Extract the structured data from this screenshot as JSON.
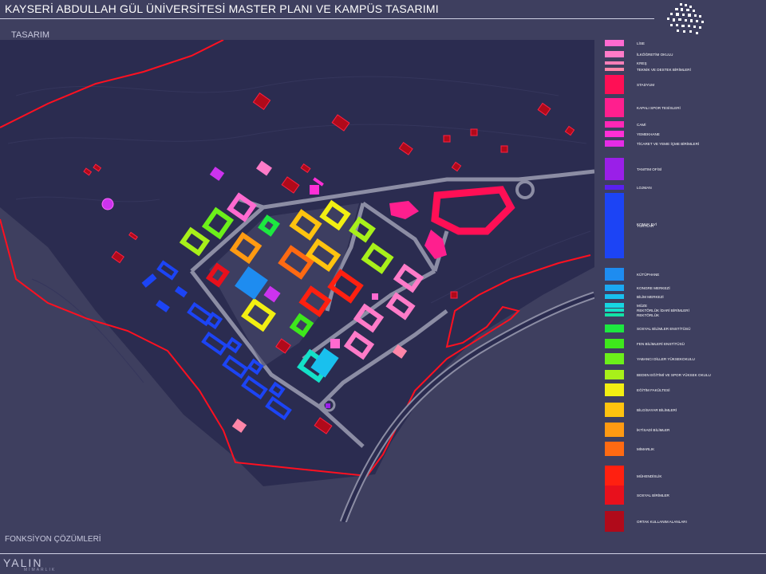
{
  "header": {
    "title": "KAYSERİ ABDULLAH GÜL ÜNİVERSİTESİ MASTER PLANI VE KAMPÜS TASARIMI",
    "section": "TASARIM"
  },
  "footer": {
    "label": "FONKSİYON ÇÖZÜMLERİ",
    "brand": "YALIN",
    "brand_sub": "MİMARLIK"
  },
  "colors": {
    "background": "#3e3f5f",
    "site": "#2b2c50",
    "boundary": "#ff1020",
    "road": "#8c8da4"
  },
  "legend": [
    {
      "label": "LİSE",
      "color": "#ff6ad0"
    },
    {
      "label": "İLKÖĞRETİM OKULU",
      "color": "#ff7bc8"
    },
    {
      "label": "KREŞ",
      "color": "#ff7fb8"
    },
    {
      "label": "TEKNİK VE DESTEK BİRİMLERİ",
      "color": "#ff86a8"
    },
    {
      "label": "STADYUM",
      "color": "#ff0f55"
    },
    {
      "label": "KAPALI SPOR TESİSLERİ",
      "color": "#ff1f8e"
    },
    {
      "label": "CAMİ",
      "color": "#ff27b6"
    },
    {
      "label": "YEMEKHANE",
      "color": "#ff2fd6"
    },
    {
      "label": "TİCARET VE YEME İÇME BİRİMLERİ",
      "color": "#e52ce6"
    },
    {
      "label": "TANITIM OFİSİ",
      "color": "#9a1fe8"
    },
    {
      "label": "LOJMAN",
      "color": "#5a20f0"
    },
    {
      "label": "KONUK EVİ",
      "color": "#3a36ff"
    },
    {
      "label": "YURTLAR",
      "color": "#1c44f5"
    },
    {
      "label": "KÜTÜPHANE",
      "color": "#1e8cf0"
    },
    {
      "label": "KONGRE MERKEZİ",
      "color": "#1ba8f2"
    },
    {
      "label": "BİLİM MERKEZİ",
      "color": "#19c0ee"
    },
    {
      "label": "MÜZE",
      "color": "#16d6e2"
    },
    {
      "label": "REKTÖRLÜK İDARİ BİRİMLERİ",
      "color": "#14e0c8"
    },
    {
      "label": "REKTÖRLÜK",
      "color": "#12e3a6"
    },
    {
      "label": "SOSYAL BİLİMLER ENSTİTÜSÜ",
      "color": "#1de840"
    },
    {
      "label": "FEN BİLİMLERİ ENSTİTÜSÜ",
      "color": "#3ee81c"
    },
    {
      "label": "YABANCI DİLLER YÜKSEKOKULU",
      "color": "#6cf01a"
    },
    {
      "label": "BEDEN EĞİTİMİ VE SPOR YÜKSEK OKULU",
      "color": "#a8f01a"
    },
    {
      "label": "EĞİTİM FAKÜLTESİ",
      "color": "#f2ef12"
    },
    {
      "label": "BİLGİSAYAR BİLİMLERİ",
      "color": "#ffc30f"
    },
    {
      "label": "İKTİSADİ BİLİMLER",
      "color": "#ff9a12"
    },
    {
      "label": "MİMARLIK",
      "color": "#ff6a12"
    },
    {
      "label": "MÜHENDİSLİK",
      "color": "#ff2010"
    },
    {
      "label": "SOSYAL BİRİMLER",
      "color": "#e8101c"
    },
    {
      "label": "ORTAK KULLANIM ALANLARI",
      "color": "#b00a1a"
    }
  ]
}
